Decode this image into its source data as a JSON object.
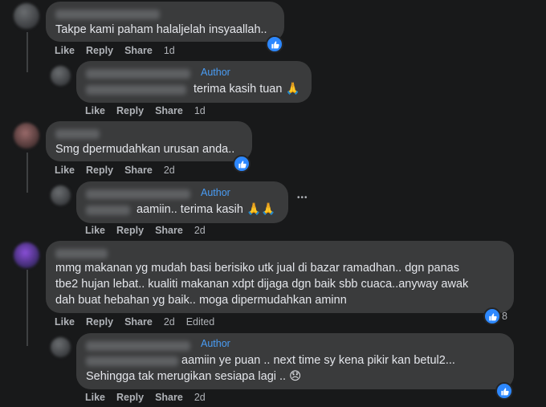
{
  "comments": [
    {
      "text": "Takpe kami paham halaljelah insyaallah..",
      "actions": {
        "like": "Like",
        "reply": "Reply",
        "share": "Share",
        "time": "1d"
      }
    },
    {
      "author_tag": "Author",
      "text": "terima kasih tuan 🙏",
      "actions": {
        "like": "Like",
        "reply": "Reply",
        "share": "Share",
        "time": "1d"
      }
    },
    {
      "text": "Smg dpermudahkan urusan anda..",
      "actions": {
        "like": "Like",
        "reply": "Reply",
        "share": "Share",
        "time": "2d"
      }
    },
    {
      "author_tag": "Author",
      "text": "aamiin.. terima kasih 🙏🙏",
      "actions": {
        "like": "Like",
        "reply": "Reply",
        "share": "Share",
        "time": "2d"
      },
      "more": "•••"
    },
    {
      "lines": [
        "mmg makanan yg mudah basi berisiko utk jual di bazar ramadhan.. dgn panas",
        "tbe2 hujan lebat.. kualiti makanan xdpt dijaga dgn baik sbb cuaca..anyway awak",
        "dah buat hebahan yg baik.. moga dipermudahkan aminn"
      ],
      "reaction_count": "8",
      "actions": {
        "like": "Like",
        "reply": "Reply",
        "share": "Share",
        "time": "2d",
        "edited": "Edited"
      }
    },
    {
      "author_tag": "Author",
      "lines": [
        "aamiin ye puan .. next time sy kena pikir kan betul2...",
        "Sehingga tak merugikan sesiapa lagi .. 😞"
      ],
      "actions": {
        "like": "Like",
        "reply": "Reply",
        "share": "Share",
        "time": "2d"
      }
    }
  ],
  "colors": {
    "background": "#18191a",
    "bubble": "#3a3b3c",
    "author": "#4a9df5",
    "like_badge": "#2d88ff"
  }
}
